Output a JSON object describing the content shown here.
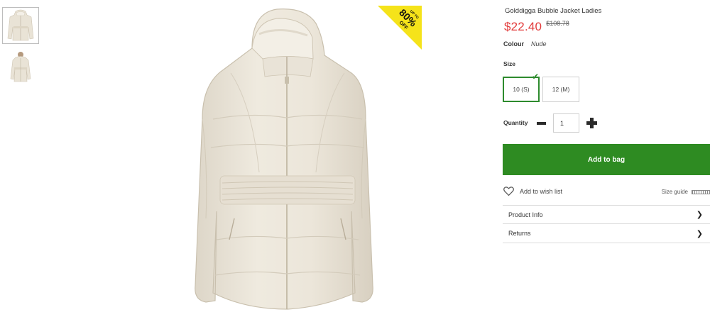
{
  "product": {
    "title": "Golddigga Bubble Jacket Ladies",
    "price_now": "$22.40",
    "price_was": "$108.78"
  },
  "badge": {
    "top_text": "UP TO",
    "main_text": "80%",
    "sub_text": "OFF",
    "color": "#f5e31a"
  },
  "colour": {
    "label": "Colour",
    "value": "Nude"
  },
  "size": {
    "label": "Size",
    "options": [
      {
        "label": "10 (S)",
        "selected": true
      },
      {
        "label": "12 (M)",
        "selected": false
      }
    ]
  },
  "quantity": {
    "label": "Quantity",
    "value": "1"
  },
  "actions": {
    "add_to_bag": "Add to bag",
    "wish_list": "Add to wish list",
    "size_guide": "Size guide"
  },
  "accordion": [
    {
      "label": "Product Info"
    },
    {
      "label": "Returns"
    }
  ],
  "icons": {
    "minus": "minus-icon",
    "plus": "plus-icon",
    "heart": "heart-icon",
    "chevron": "chevron-right-icon",
    "check": "checkmark-icon",
    "ruler": "ruler-icon"
  },
  "colors": {
    "price": "#e23b3b",
    "accent_green": "#2e8b22",
    "jacket": "#ece6da"
  }
}
